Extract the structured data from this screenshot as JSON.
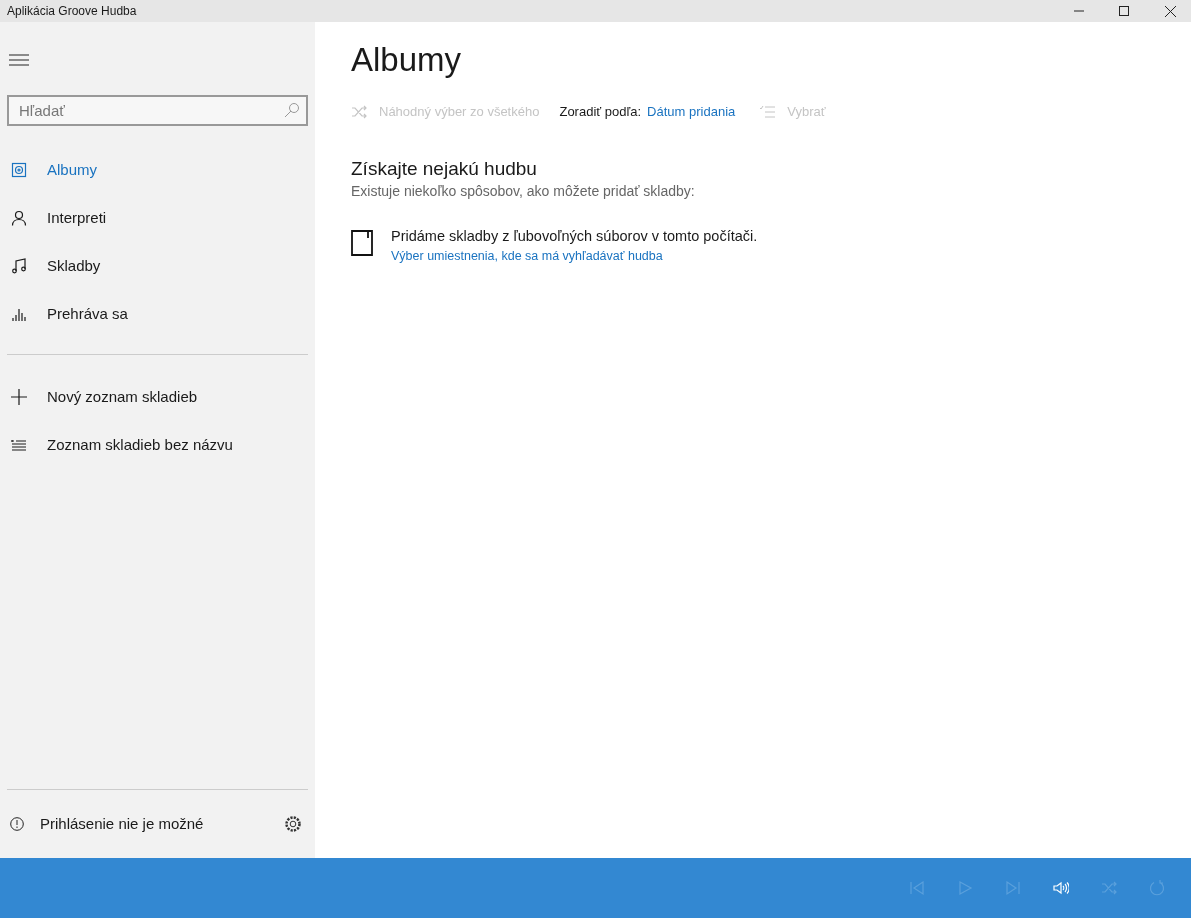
{
  "window": {
    "title": "Aplikácia Groove Hudba"
  },
  "sidebar": {
    "search": {
      "placeholder": "Hľadať"
    },
    "nav": [
      {
        "kind": "album",
        "label": "Albumy",
        "selected": true
      },
      {
        "kind": "artist",
        "label": "Interpreti",
        "selected": false
      },
      {
        "kind": "song",
        "label": "Skladby",
        "selected": false
      },
      {
        "kind": "playing",
        "label": "Prehráva sa",
        "selected": false
      }
    ],
    "playlists": [
      {
        "kind": "new",
        "label": "Nový zoznam skladieb"
      },
      {
        "kind": "list",
        "label": "Zoznam skladieb bez názvu"
      }
    ],
    "account": {
      "label": "Prihlásenie nie je možné"
    }
  },
  "main": {
    "title": "Albumy",
    "toolbar": {
      "shuffle": {
        "label": "Náhodný výber zo všetkého",
        "disabled": true
      },
      "sort_label": "Zoradiť podľa:",
      "sort_value": "Dátum pridania",
      "select": {
        "label": "Vybrať",
        "disabled": true
      }
    },
    "empty": {
      "heading": "Získajte nejakú hudbu",
      "subheading": "Existuje niekoľko spôsobov, ako môžete pridať skladby:",
      "option_text": "Pridáme skladby z ľubovoľných súborov v tomto počítači.",
      "option_link": "Výber umiestnenia, kde sa má vyhľadávať hudba"
    }
  },
  "player": [
    {
      "kind": "previous",
      "disabled": true
    },
    {
      "kind": "play",
      "disabled": true
    },
    {
      "kind": "next",
      "disabled": true
    },
    {
      "kind": "volume",
      "disabled": false
    },
    {
      "kind": "shuffle",
      "disabled": true
    },
    {
      "kind": "repeat",
      "disabled": true
    }
  ]
}
